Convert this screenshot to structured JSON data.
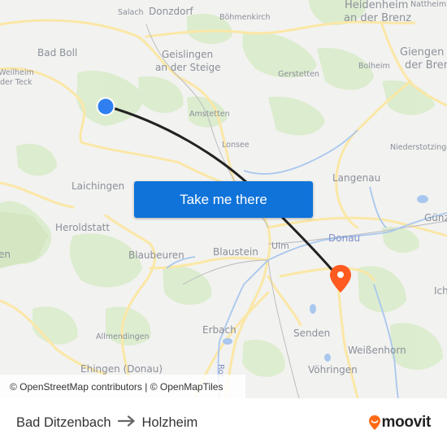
{
  "map": {
    "places": [
      {
        "name": "Salach",
        "size": "sm"
      },
      {
        "name": "Donzdorf",
        "size": "md"
      },
      {
        "name": "Böhmenkirch",
        "size": "sm"
      },
      {
        "name": "Heidenheim",
        "size": "lg"
      },
      {
        "name": "an der Brenz",
        "size": "lg"
      },
      {
        "name": "Nattheim",
        "size": "sm"
      },
      {
        "name": "Bad Boll",
        "size": "md"
      },
      {
        "name": "Geislingen",
        "size": "md"
      },
      {
        "name": "an der Steige",
        "size": "md"
      },
      {
        "name": "Giengen a",
        "size": "lg"
      },
      {
        "name": "der Brenz",
        "size": "lg"
      },
      {
        "name": "Weilheim",
        "size": "sm"
      },
      {
        "name": "der Teck",
        "size": "sm"
      },
      {
        "name": "Bolheim",
        "size": "sm"
      },
      {
        "name": "Gerstetten",
        "size": "sm"
      },
      {
        "name": "Amstetten",
        "size": "sm"
      },
      {
        "name": "Lonsee",
        "size": "sm"
      },
      {
        "name": "Niederstotzingen",
        "size": "sm"
      },
      {
        "name": "Laichingen",
        "size": "md"
      },
      {
        "name": "Langenau",
        "size": "md"
      },
      {
        "name": "Heroldstatt",
        "size": "md"
      },
      {
        "name": "Günz",
        "size": "md"
      },
      {
        "name": "en",
        "size": "md"
      },
      {
        "name": "Blaubeuren",
        "size": "md"
      },
      {
        "name": "Blaustein",
        "size": "md"
      },
      {
        "name": "Donau",
        "size": "water"
      },
      {
        "name": "Ulm",
        "size": "md"
      },
      {
        "name": "Ich",
        "size": "md"
      },
      {
        "name": "Allmendingen",
        "size": "sm"
      },
      {
        "name": "Erbach",
        "size": "md"
      },
      {
        "name": "Senden",
        "size": "md"
      },
      {
        "name": "Weißenhorn",
        "size": "md"
      },
      {
        "name": "Ehingen (Donau)",
        "size": "md"
      },
      {
        "name": "Vöhringen",
        "size": "md"
      },
      {
        "name": "Rot",
        "size": "river"
      }
    ],
    "route": {
      "origin_marker": "origin-dot",
      "destination_marker": "destination-pin",
      "origin_color": "#2f7ff0",
      "destination_color": "#ff5a1f",
      "line_color": "#222222"
    }
  },
  "cta": {
    "label": "Take me there",
    "color": "#0f73d9"
  },
  "attribution": {
    "text": "© OpenStreetMap contributors | © OpenMapTiles"
  },
  "footer": {
    "origin": "Bad Ditzenbach",
    "arrow_icon": "arrow-right-icon",
    "destination": "Holzheim",
    "logo_text": "moovit",
    "logo_color": "#ff6a13"
  }
}
